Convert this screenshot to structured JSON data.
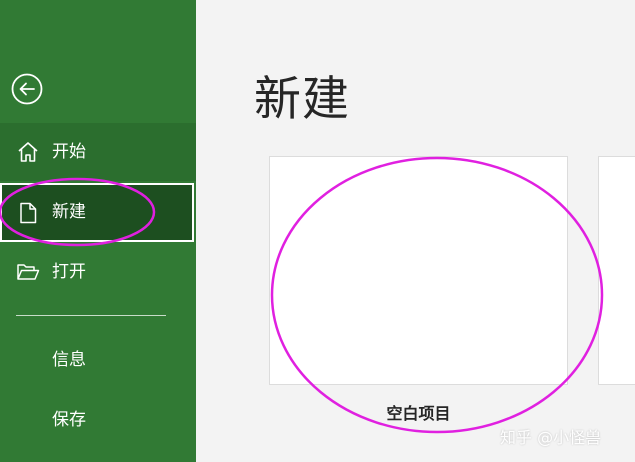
{
  "sidebar": {
    "back_icon": "arrow-left-circle-icon",
    "items": [
      {
        "label": "开始",
        "icon": "home-icon"
      },
      {
        "label": "新建",
        "icon": "document-icon",
        "selected": true
      },
      {
        "label": "打开",
        "icon": "folder-open-icon"
      }
    ],
    "secondary_items": [
      {
        "label": "信息"
      },
      {
        "label": "保存"
      }
    ]
  },
  "main": {
    "title": "新建",
    "templates": [
      {
        "label": "空白项目"
      }
    ]
  },
  "watermark": "知乎 @小怪兽",
  "colors": {
    "sidebar_bg": "#317a34",
    "selected_bg": "#1d4f20",
    "annotation": "#e020e0"
  }
}
